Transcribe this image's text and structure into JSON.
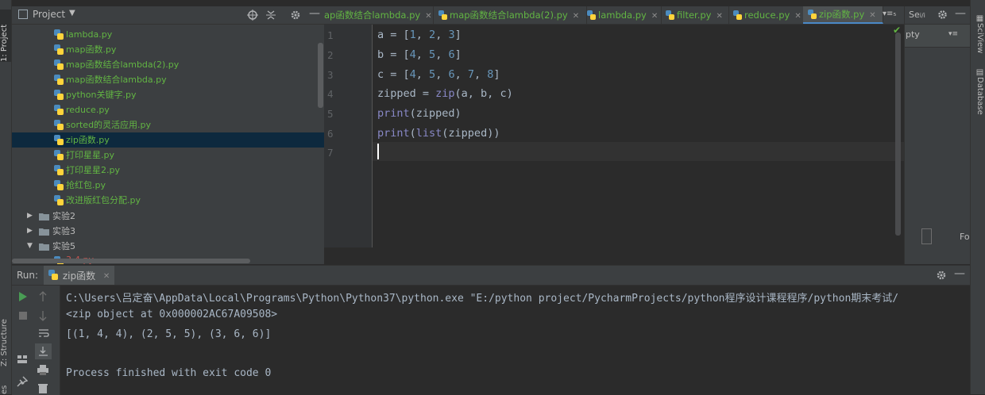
{
  "left_strip": {
    "project_tab": "1: Project",
    "structure_tab": "Z: Structure",
    "favorites_tab": "es"
  },
  "project_panel": {
    "title": "Project",
    "files": [
      {
        "name": "lambda.py"
      },
      {
        "name": "map函数.py"
      },
      {
        "name": "map函数结合lambda(2).py"
      },
      {
        "name": "map函数结合lambda.py"
      },
      {
        "name": "python关键字.py"
      },
      {
        "name": "reduce.py"
      },
      {
        "name": "sorted的灵活应用.py"
      },
      {
        "name": "zip函数.py",
        "selected": true
      },
      {
        "name": "打印星星.py"
      },
      {
        "name": "打印星星2.py"
      },
      {
        "name": "抢红包.py"
      },
      {
        "name": "改进版红包分配.py"
      }
    ],
    "folders": [
      {
        "name": "实验2",
        "expanded": false
      },
      {
        "name": "实验3",
        "expanded": false
      },
      {
        "name": "实验5",
        "expanded": true
      }
    ],
    "partial_file": "3-4.py"
  },
  "editor_tabs": [
    {
      "label": "ap函数结合lambda.py"
    },
    {
      "label": "map函数结合lambda(2).py"
    },
    {
      "label": "lambda.py"
    },
    {
      "label": "filter.py"
    },
    {
      "label": "reduce.py"
    },
    {
      "label": "zip函数.py",
      "active": true
    }
  ],
  "tab_overflow": "▾≡₅",
  "editor": {
    "line_numbers": [
      "1",
      "2",
      "3",
      "4",
      "5",
      "6",
      "7"
    ],
    "code": {
      "l1": {
        "prefix": "a = [",
        "n1": "1",
        "sep1": ", ",
        "n2": "2",
        "sep2": ", ",
        "n3": "3",
        "suffix": "]"
      },
      "l2": {
        "prefix": "b = [",
        "n1": "4",
        "sep1": ", ",
        "n2": "5",
        "sep2": ", ",
        "n3": "6",
        "suffix": "]"
      },
      "l3": {
        "prefix": "c = [",
        "n1": "4",
        "sep1": ", ",
        "n2": "5",
        "sep2": ", ",
        "n3": "6",
        "sep3": ", ",
        "n4": "7",
        "sep4": ", ",
        "n5": "8",
        "suffix": "]"
      },
      "l4": {
        "prefix": "zipped = ",
        "fn": "zip",
        "args": "(a, b, c)"
      },
      "l5": {
        "fn": "print",
        "args": "(zipped)"
      },
      "l6": {
        "fn": "print",
        "open": "(",
        "fn2": "list",
        "args": "(zipped))"
      }
    }
  },
  "right_panel": {
    "title": "Se",
    "title_suffix": "i/i",
    "tab": "pty",
    "footer": "For"
  },
  "right_strip": {
    "sciview": "SciView",
    "database": "Database"
  },
  "run_panel": {
    "run_label": "Run:",
    "tab_label": "zip函数",
    "output": [
      "C:\\Users\\吕定奋\\AppData\\Local\\Programs\\Python\\Python37\\python.exe \"E:/python project/PycharmProjects/python程序设计课程程序/python期末考试/",
      "<zip object at 0x000002AC67A09508>",
      "[(1, 4, 4), (2, 5, 5), (3, 6, 6)]",
      "",
      "Process finished with exit code 0"
    ]
  },
  "colors": {
    "background": "#2b2b2b",
    "panel": "#3c3f41",
    "file_green": "#62b543",
    "number": "#6897bb",
    "builtin": "#8888c6",
    "selection": "#0d293e"
  }
}
